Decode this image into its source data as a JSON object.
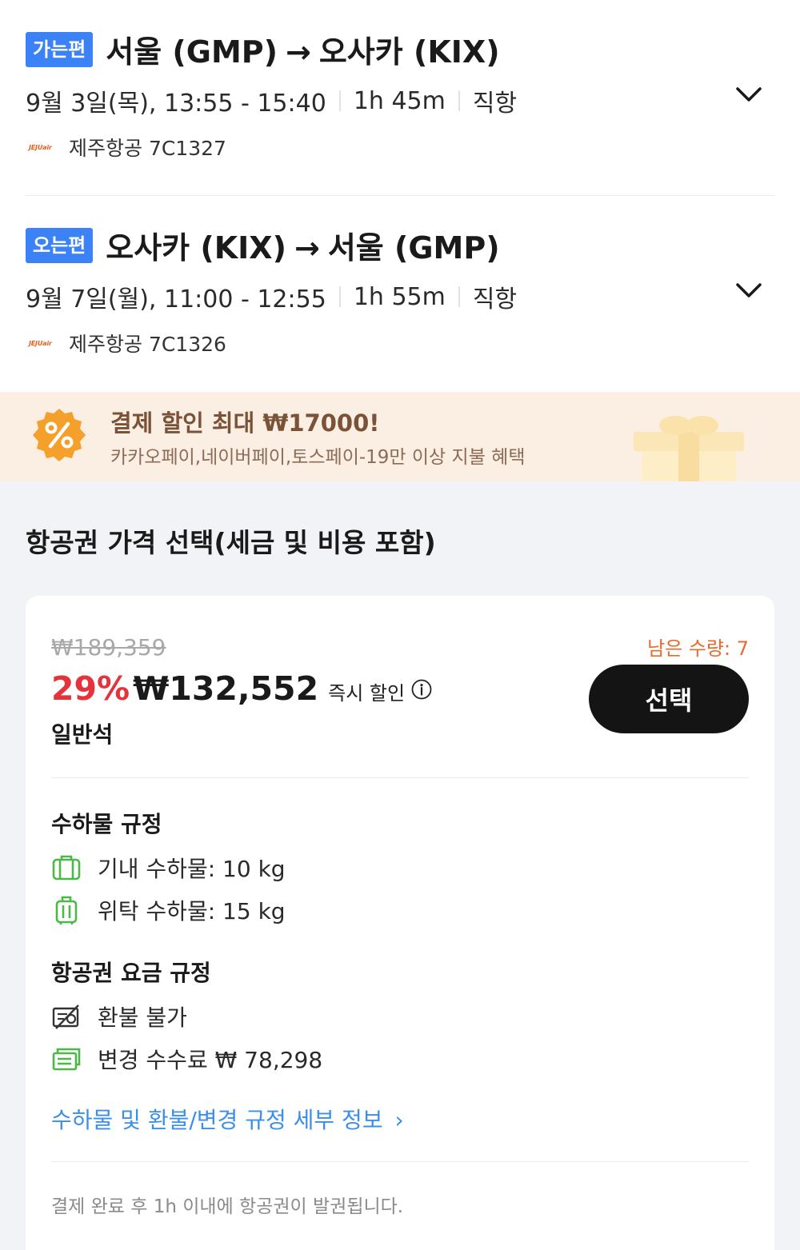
{
  "outbound": {
    "badge": "가는편",
    "origin": "서울 (GMP)",
    "arrow": "→",
    "destination": "오사카 (KIX)",
    "date_time": "9월 3일(목), 13:55 - 15:40",
    "duration": "1h 45m",
    "type": "직항",
    "airline_logo": "JEJUair",
    "airline": "제주항공 7C1327"
  },
  "inbound": {
    "badge": "오는편",
    "origin": "오사카 (KIX)",
    "arrow": "→",
    "destination": "서울 (GMP)",
    "date_time": "9월 7일(월), 11:00 - 12:55",
    "duration": "1h 55m",
    "type": "직항",
    "airline_logo": "JEJUair",
    "airline": "제주항공 7C1326"
  },
  "promo": {
    "title": "결제 할인 최대 ₩17000!",
    "subtitle": "카카오페이,네이버페이,토스페이-19만 이상 지불 혜택",
    "icon": "percent-badge-icon"
  },
  "price_section": {
    "title": "항공권 가격 선택(세금 및 비용 포함)"
  },
  "fare": {
    "original_price": "₩189,359",
    "remaining": "남은 수량: 7",
    "discount": "29%",
    "price": "₩132,552",
    "instant_discount": "즉시 할인",
    "seat_class": "일반석",
    "select_label": "선택",
    "baggage_title": "수하물 규정",
    "carry_on": "기내 수하물: 10 kg",
    "checked": "위탁 수하물: 15 kg",
    "fare_rules_title": "항공권 요금 규정",
    "refund": "환불 불가",
    "change_fee": "변경 수수료 ₩ 78,298",
    "details_link": "수하물 및 환불/변경 규정 세부 정보",
    "details_chevron": "›",
    "footer_note": "결제 완료 후 1h 이내에 항공권이 발권됩니다."
  },
  "colors": {
    "badge_blue": "#3b82f6",
    "discount_red": "#e5333b",
    "remaining_orange": "#e86a2c",
    "link_blue": "#3a8fe8",
    "icon_green": "#4cb848",
    "promo_bg": "#fbeee2"
  }
}
